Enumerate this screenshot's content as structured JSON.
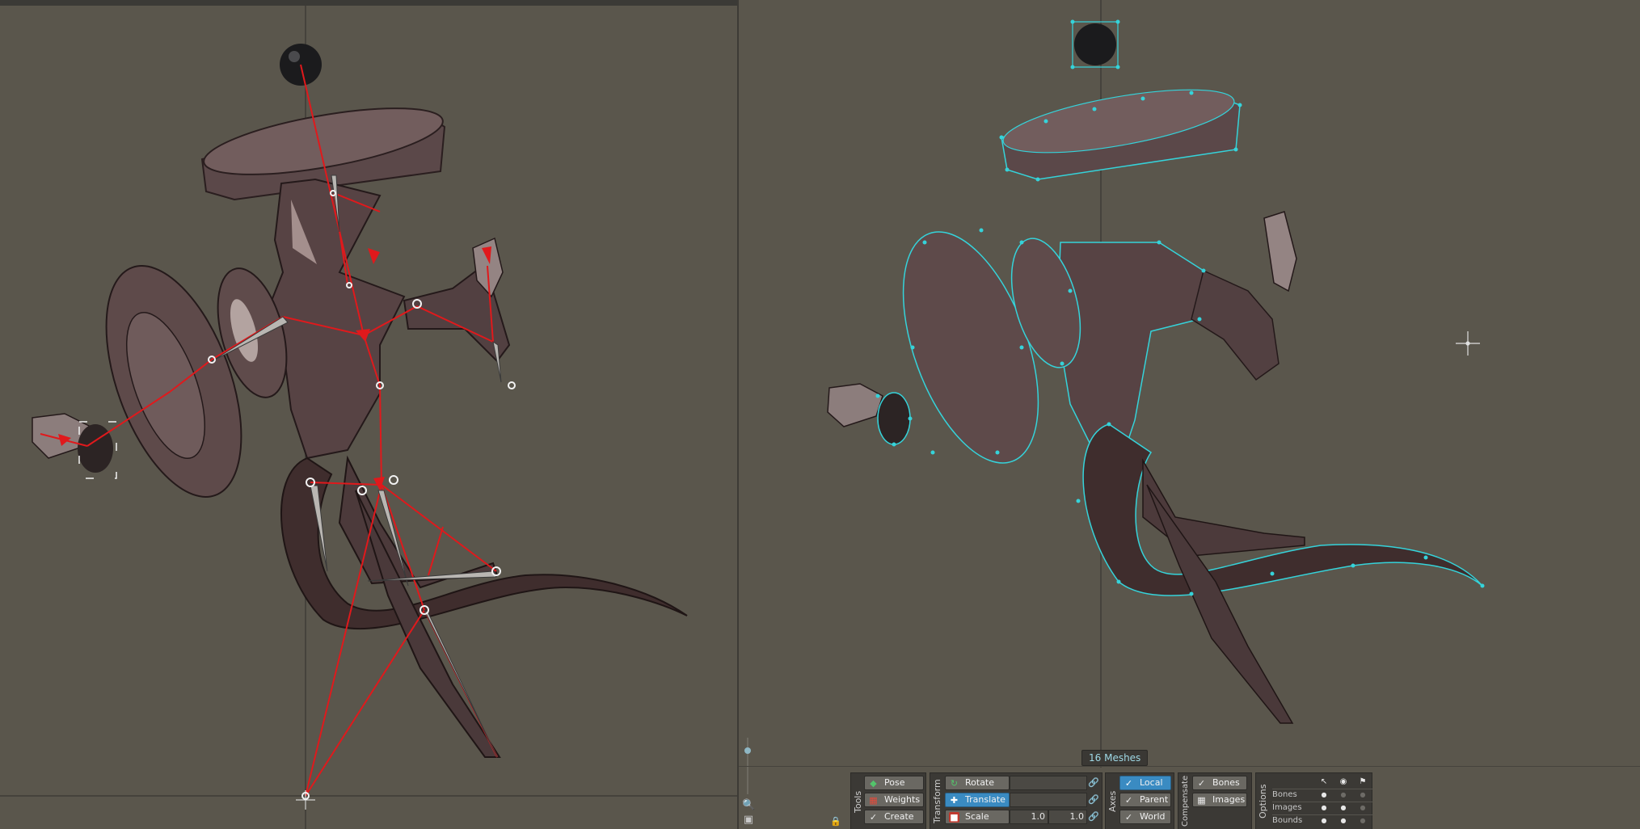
{
  "status": {
    "mesh_count": "16 Meshes"
  },
  "tools": {
    "title": "Tools",
    "pose": "Pose",
    "weights": "Weights",
    "create": "Create"
  },
  "transform": {
    "title": "Transform",
    "rotate": "Rotate",
    "translate": "Translate",
    "scale": "Scale",
    "scale_x": "1.0",
    "scale_y": "1.0"
  },
  "axes": {
    "title": "Axes",
    "local": "Local",
    "parent": "Parent",
    "world": "World"
  },
  "compensate": {
    "title": "Compensate",
    "bones": "Bones",
    "images": "Images"
  },
  "options": {
    "title": "Options",
    "rows": [
      "Bones",
      "Images",
      "Bounds"
    ]
  },
  "icons": {
    "pose": "pose-icon",
    "weights": "weights-icon",
    "create": "create-bone-icon",
    "rotate": "rotate-icon",
    "translate": "translate-icon",
    "scale": "scale-icon",
    "select": "cursor-icon",
    "visibility": "eye-icon",
    "tag": "tag-icon",
    "zoom": "magnifier-icon",
    "fit": "fit-view-icon",
    "lock": "lock-icon"
  },
  "colors": {
    "viewport_bg": "#5a564c",
    "bone": "#e0191c",
    "mesh_vertex": "#35d3da",
    "active_button": "#3a8bc2",
    "panel_bg": "#3b3935"
  }
}
